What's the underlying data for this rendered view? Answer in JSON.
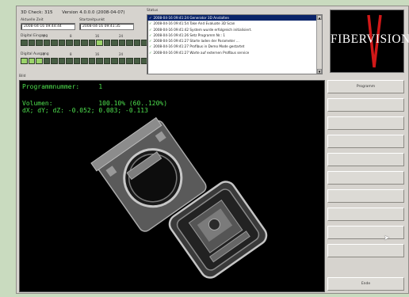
{
  "app": {
    "title": "3D Check: 315",
    "version": "Version 4.0.0.0 (2008-04-07)"
  },
  "info": {
    "aktuelle_zeit_label": "Aktuelle Zeit",
    "aktuelle_zeit_value": "2008-04-16 09:44:44",
    "startzeit_label": "Startzeitpunkt",
    "startzeit_value": "2008-04-16 09:41:35",
    "digital_eingang_label": "Digital Eingang",
    "digital_ausgang_label": "Digital Ausgang",
    "ticks": [
      "0",
      "8",
      "16",
      "24"
    ]
  },
  "status": {
    "label": "Status",
    "rows": [
      "2008-04-16 09:41:24 Generator 3D Anstalten",
      "2008-04-16 09:41:54 Take And Evaluate 3D Scan",
      "2008-04-16 09:41:42 System wurde erfolgreich initialisiert.",
      "2008-04-16 09:41:26 Setz Programm Nr.: 1",
      "2008-04-16 09:41:27 Starte laden der Parameter ...",
      "2008-04-16 09:41:27 Profibus in Demo Mode gestartet",
      "2008-04-16 09:41:27 Warte auf externen Profibus service"
    ]
  },
  "logo": {
    "text": "FIBERVISION"
  },
  "main": {
    "label": "Bild",
    "program_line": "Programmnummer:     1",
    "volumen_line": "Volumen:            100.10% (60..120%)",
    "dxyz_line": "dX; dY; dZ: -0.052; 0.083; -0.113"
  },
  "buttons": {
    "programm": "Programm",
    "ende": "Ende"
  },
  "colors": {
    "window_bg": "#d6d3ce",
    "overlay_text": "#4ee04e",
    "led_on": "#9bd36a",
    "led_off": "#475d43",
    "logo_accent": "#d01818"
  }
}
